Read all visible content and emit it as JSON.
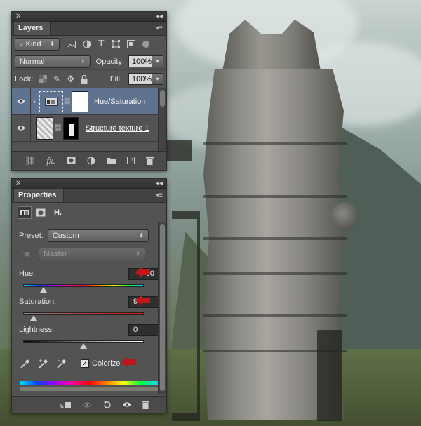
{
  "layers_panel": {
    "title": "Layers",
    "filter": {
      "label": "Kind"
    },
    "blend_mode": "Normal",
    "opacity": {
      "label": "Opacity:",
      "value": "100%"
    },
    "lock": {
      "label": "Lock:"
    },
    "fill": {
      "label": "Fill:",
      "value": "100%"
    },
    "layers": [
      {
        "name": "Hue/Saturation",
        "selected": true
      },
      {
        "name": "Structure texture 1",
        "selected": false
      }
    ]
  },
  "properties_panel": {
    "title": "Properties",
    "header_label": "H.",
    "preset": {
      "label": "Preset:",
      "value": "Custom"
    },
    "channel": {
      "value": "Master"
    },
    "hue": {
      "label": "Hue:",
      "value": "60",
      "fraction": 0.167
    },
    "saturation": {
      "label": "Saturation:",
      "value": "9",
      "fraction": 0.09
    },
    "lightness": {
      "label": "Lightness:",
      "value": "0",
      "fraction": 0.5
    },
    "colorize": {
      "label": "Colorize",
      "checked": true
    }
  },
  "colors": {
    "panel": "#535353",
    "selected_layer": "#5f7290",
    "arrow": "#c1141b"
  }
}
